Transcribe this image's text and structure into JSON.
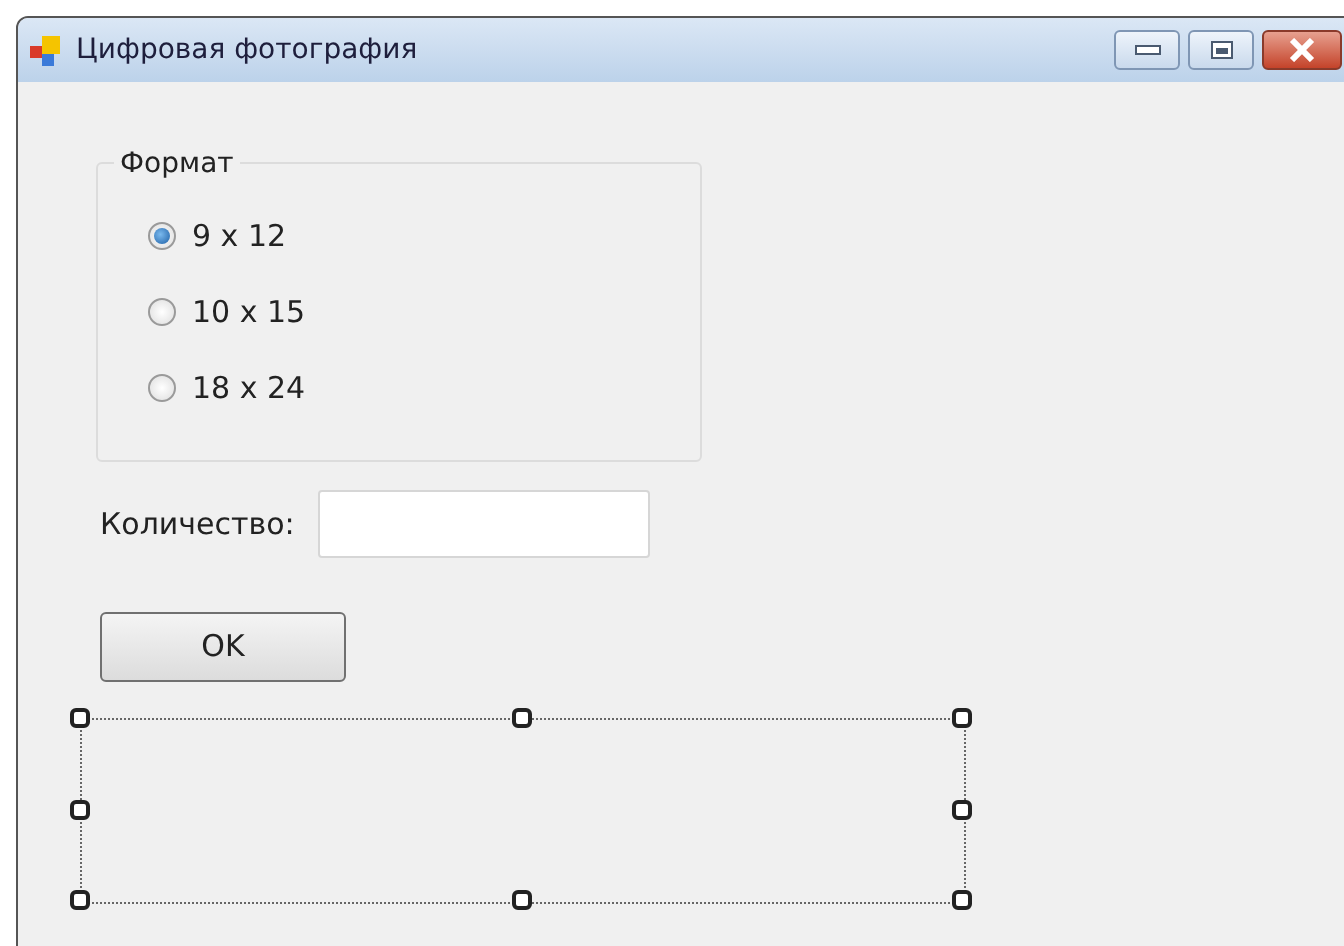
{
  "window": {
    "title": "Цифровая фотография"
  },
  "format_group": {
    "title": "Формат",
    "options": [
      {
        "label": "9 x 12",
        "selected": true
      },
      {
        "label": "10 x 15",
        "selected": false
      },
      {
        "label": "18 x 24",
        "selected": false
      }
    ]
  },
  "quantity": {
    "label": "Количество:"
  },
  "ok_button": {
    "label": "OK"
  }
}
